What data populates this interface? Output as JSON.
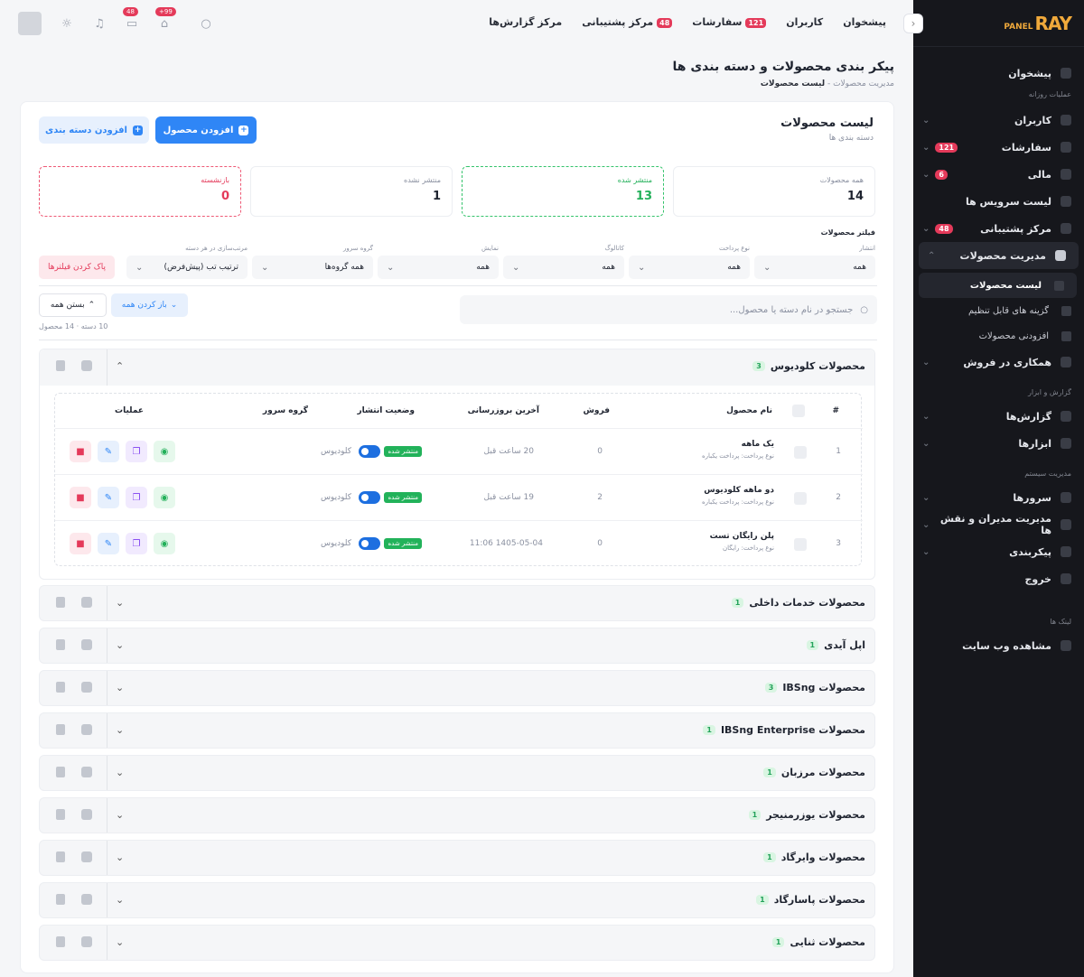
{
  "logo": {
    "ray": "RAY",
    "panel": "PANEL"
  },
  "sidebar": {
    "dashboard": "پیشخوان",
    "sec_daily": "عملیات روزانه",
    "users": "کاربران",
    "orders": "سفارشات",
    "orders_badge": "121",
    "finance": "مالی",
    "finance_badge": "6",
    "services": "لیست سرویس ها",
    "support": "مرکز پشتیبانی",
    "support_badge": "48",
    "products": "مدیریت محصولات",
    "sub_list": "لیست محصولات",
    "sub_options": "گزینه های قابل تنظیم",
    "sub_addons": "افزودنی محصولات",
    "affiliate": "همکاری در فروش",
    "sec_reports": "گزارش و ابزار",
    "reports": "گزارش‌ها",
    "tools": "ابزارها",
    "sec_system": "مدیریت سیستم",
    "servers": "سرورها",
    "admins": "مدیریت مدیران و نقش ها",
    "config": "پیکربندی",
    "logout": "خروج",
    "sec_links": "لینک ها",
    "website": "مشاهده وب سایت"
  },
  "topbar": {
    "nav": [
      "پیشخوان",
      "کاربران",
      "سفارشات",
      "مرکز پشتیبانی",
      "مرکز گزارش‌ها"
    ],
    "orders_badge": "121",
    "support_badge": "48",
    "cart_badge": "+99",
    "msg_badge": "48"
  },
  "page": {
    "title": "پیکر بندی محصولات و دسته بندی ها",
    "breadcrumb_parent": "مدیریت محصولات",
    "breadcrumb_sep": "-",
    "breadcrumb_current": "لیست محصولات"
  },
  "card": {
    "title": "لیست محصولات",
    "subtitle": "دسته بندی ها",
    "add_product": "افزودن محصول",
    "add_category": "افزودن دسته بندی"
  },
  "stats": [
    {
      "label": "همه محصولات",
      "value": "14"
    },
    {
      "label": "منتشر شده",
      "value": "13"
    },
    {
      "label": "منتشر نشده",
      "value": "1"
    },
    {
      "label": "بازنشسته",
      "value": "0"
    }
  ],
  "filters": {
    "title": "فیلتر محصولات",
    "items": [
      {
        "label": "انتشار",
        "value": "همه"
      },
      {
        "label": "نوع پرداخت",
        "value": "همه"
      },
      {
        "label": "کاتالوگ",
        "value": "همه"
      },
      {
        "label": "نمایش",
        "value": "همه"
      },
      {
        "label": "گروه سرور",
        "value": "همه گروه‌ها"
      },
      {
        "label": "مرتب‌سازی در هر دسته",
        "value": "ترتیب تب (پیش‌فرض)"
      }
    ],
    "clear": "پاک کردن فیلترها"
  },
  "search": {
    "placeholder": "جستجو در نام دسته یا محصول..."
  },
  "expand_all": "باز کردن همه",
  "collapse_all": "بستن همه",
  "counts": "10 دسته · 14 محصول",
  "open_category": {
    "name": "محصولات کلودیوس",
    "count": "3"
  },
  "table": {
    "headers": {
      "num": "#",
      "name": "نام محصول",
      "sales": "فروش",
      "updated": "آخرین بروزرسانی",
      "status": "وضعیت انتشار",
      "group": "گروه سرور",
      "actions": "عملیات"
    },
    "rows": [
      {
        "num": "1",
        "name": "یک ماهه",
        "pay": "نوع پرداخت: پرداخت یکباره",
        "sales": "0",
        "updated": "20 ساعت قبل",
        "status": "منتشر شده",
        "group": "کلودیوس"
      },
      {
        "num": "2",
        "name": "دو ماهه کلودیوس",
        "pay": "نوع پرداخت: پرداخت یکباره",
        "sales": "2",
        "updated": "19 ساعت قبل",
        "status": "منتشر شده",
        "group": "کلودیوس"
      },
      {
        "num": "3",
        "name": "پلن رایگان تست",
        "pay": "نوع پرداخت: رایگان",
        "sales": "0",
        "updated": "1405-05-04 11:06",
        "status": "منتشر شده",
        "group": "کلودیوس"
      }
    ]
  },
  "categories": [
    {
      "name": "محصولات خدمات داخلی",
      "count": "1"
    },
    {
      "name": "اپل آیدی",
      "count": "1"
    },
    {
      "name": "محصولات IBSng",
      "count": "3"
    },
    {
      "name": "محصولات IBSng Enterprise",
      "count": "1"
    },
    {
      "name": "محصولات مرزبان",
      "count": "1"
    },
    {
      "name": "محصولات یوزرمنیجر",
      "count": "1"
    },
    {
      "name": "محصولات وایرگاد",
      "count": "1"
    },
    {
      "name": "محصولات پاسارگاد",
      "count": "1"
    },
    {
      "name": "محصولات ثنایی",
      "count": "1"
    }
  ]
}
